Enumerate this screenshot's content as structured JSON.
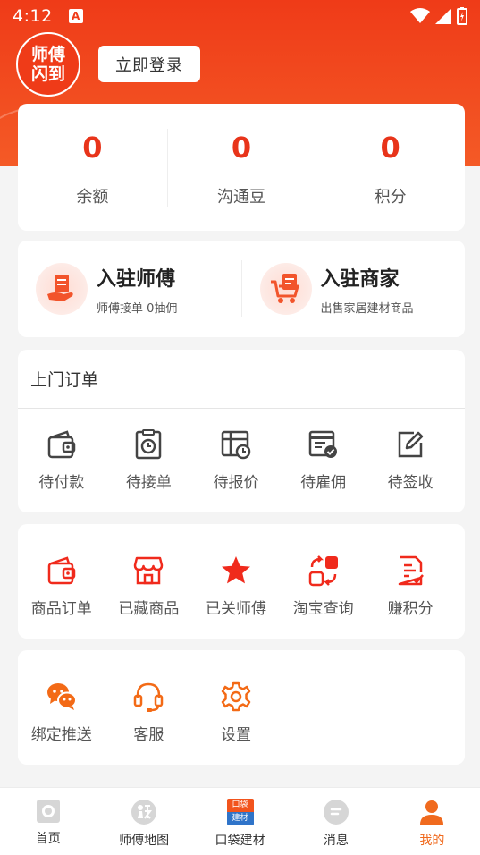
{
  "status_bar": {
    "time": "4:12",
    "notification_glyph": "A"
  },
  "header": {
    "avatar_line1": "师傅",
    "avatar_line2": "闪到",
    "login_label": "立即登录"
  },
  "stats": [
    {
      "value": "0",
      "label": "余额"
    },
    {
      "value": "0",
      "label": "沟通豆"
    },
    {
      "value": "0",
      "label": "积分"
    }
  ],
  "join": [
    {
      "title": "入驻师傅",
      "subtitle": "师傅接单 0抽佣",
      "icon": "worker-icon"
    },
    {
      "title": "入驻商家",
      "subtitle": "出售家居建材商品",
      "icon": "merchant-cart-icon"
    }
  ],
  "orders": {
    "title": "上门订单",
    "items": [
      {
        "label": "待付款",
        "icon": "wallet-icon"
      },
      {
        "label": "待接单",
        "icon": "clipboard-clock-icon"
      },
      {
        "label": "待报价",
        "icon": "quote-clock-icon"
      },
      {
        "label": "待雇佣",
        "icon": "hire-check-icon"
      },
      {
        "label": "待签收",
        "icon": "edit-icon"
      }
    ]
  },
  "shop": {
    "items": [
      {
        "label": "商品订单",
        "icon": "wallet-icon"
      },
      {
        "label": "已藏商品",
        "icon": "store-icon"
      },
      {
        "label": "已关师傅",
        "icon": "star-icon"
      },
      {
        "label": "淘宝查询",
        "icon": "taobao-swap-icon"
      },
      {
        "label": "赚积分",
        "icon": "points-doc-icon"
      }
    ]
  },
  "tools": {
    "items": [
      {
        "label": "绑定推送",
        "icon": "wechat-icon"
      },
      {
        "label": "客服",
        "icon": "headset-icon"
      },
      {
        "label": "设置",
        "icon": "gear-icon"
      }
    ]
  },
  "tabbar": [
    {
      "label": "首页",
      "icon": "home-icon",
      "active": false
    },
    {
      "label": "师傅地图",
      "icon": "map-icon",
      "active": false
    },
    {
      "label": "口袋建材",
      "icon": "pocket-materials-icon",
      "active": false,
      "badge_top": "口袋",
      "badge_bottom": "建材"
    },
    {
      "label": "消息",
      "icon": "message-icon",
      "active": false
    },
    {
      "label": "我的",
      "icon": "profile-icon",
      "active": true
    }
  ],
  "colors": {
    "brand_red": "#ef3b18",
    "stat_red": "#e8341a",
    "orange": "#f06a1e",
    "icon_grey": "#444444"
  }
}
